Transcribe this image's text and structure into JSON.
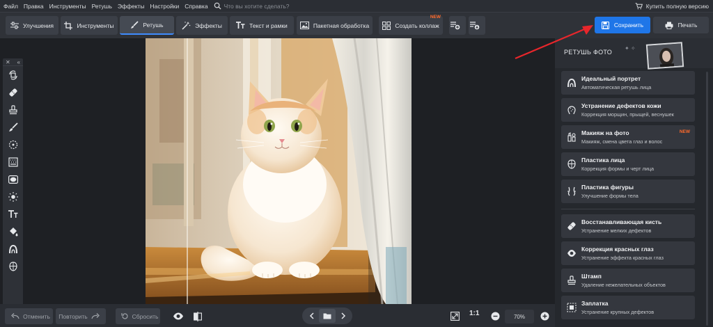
{
  "menu": {
    "items": [
      "Файл",
      "Правка",
      "Инструменты",
      "Ретушь",
      "Эффекты",
      "Настройки",
      "Справка"
    ],
    "search_placeholder": "Что вы хотите сделать?",
    "buy_label": "Купить полную версию"
  },
  "toolbar": {
    "tabs": [
      {
        "label": "Улучшения",
        "icon": "sliders-icon"
      },
      {
        "label": "Инструменты",
        "icon": "crop-icon"
      },
      {
        "label": "Ретушь",
        "icon": "brush-icon",
        "active": true
      },
      {
        "label": "Эффекты",
        "icon": "magic-wand-icon"
      },
      {
        "label": "Текст и рамки",
        "icon": "text-icon"
      },
      {
        "label": "Пакетная обработка",
        "icon": "batch-image-icon"
      },
      {
        "label": "Создать коллаж",
        "icon": "collage-icon",
        "badge": "NEW"
      }
    ],
    "save_label": "Сохранить",
    "print_label": "Печать"
  },
  "left_tools": [
    "rotate-icon",
    "patch-icon",
    "stamp-icon",
    "brush-icon",
    "radial-icon",
    "gradient-icon",
    "vignette-icon",
    "light-icon",
    "text-icon",
    "fill-icon",
    "portrait-icon",
    "face-shape-icon"
  ],
  "right_panel": {
    "title": "РЕТУШЬ ФОТО",
    "cards": [
      {
        "title": "Идеальный портрет",
        "subtitle": "Автоматическая ретушь лица",
        "icon": "portrait-icon"
      },
      {
        "title": "Устранение дефектов кожи",
        "subtitle": "Коррекция морщин, прыщей, веснушек",
        "icon": "skin-icon"
      },
      {
        "title": "Макияж на фото",
        "subtitle": "Макияж, смена цвета глаз и волос",
        "icon": "makeup-icon",
        "badge": "NEW"
      },
      {
        "title": "Пластика лица",
        "subtitle": "Коррекция формы и черт лица",
        "icon": "face-shape-icon"
      },
      {
        "title": "Пластика фигуры",
        "subtitle": "Улучшение формы тела",
        "icon": "figure-icon"
      },
      {
        "title": "Восстанавливающая кисть",
        "subtitle": "Устранение мелких дефектов",
        "icon": "patch-icon"
      },
      {
        "title": "Коррекция красных глаз",
        "subtitle": "Устранение эффекта красных глаз",
        "icon": "eye-icon"
      },
      {
        "title": "Штамп",
        "subtitle": "Удаление нежелательных объектов",
        "icon": "stamp-icon"
      },
      {
        "title": "Заплатка",
        "subtitle": "Устранение крупных дефектов",
        "icon": "patch-area-icon"
      }
    ]
  },
  "bottom": {
    "undo_label": "Отменить",
    "redo_label": "Повторить",
    "reset_label": "Сбросить",
    "one_to_one": "1:1",
    "zoom": "70%"
  }
}
